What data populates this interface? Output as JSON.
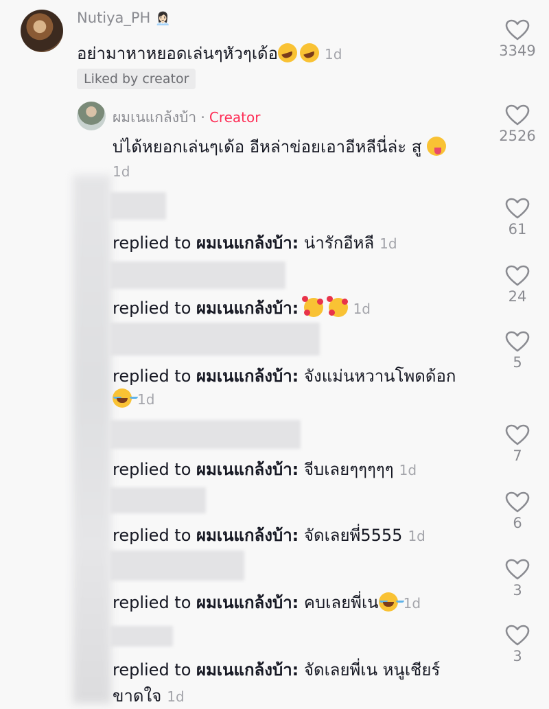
{
  "main_comment": {
    "username": "Nutiya_PH",
    "username_emoji": "👩🏻‍💼",
    "text": "อย่ามาหาหยอดเล่นๆหัวๆเด้อ",
    "time": "1d",
    "liked_badge": "Liked by creator",
    "likes": "3349"
  },
  "creator_reply": {
    "username": "ผมเนแกล้งบ้า",
    "separator": "·",
    "tag": "Creator",
    "text": "บ่ได้หยอกเล่นๆเด้อ อีหล่าข่อยเอาอีหลีนี่ล่ะ สู",
    "time": "1d",
    "likes": "2526"
  },
  "replies": [
    {
      "prefix": "replied to",
      "target": "ผมเนแกล้งบ้า:",
      "text": "น่ารักอีหลี",
      "time": "1d",
      "likes": "61"
    },
    {
      "prefix": "replied to",
      "target": "ผมเนแกล้งบ้า:",
      "text": "",
      "time": "1d",
      "likes": "24"
    },
    {
      "prefix": "replied to",
      "target": "ผมเนแกล้งบ้า:",
      "text": "จังแม่นหวานโพดด้อก",
      "time": "1d",
      "likes": "5"
    },
    {
      "prefix": "replied to",
      "target": "ผมเนแกล้งบ้า:",
      "text": "จีบเลยๆๆๆๆๆ",
      "time": "1d",
      "likes": "7"
    },
    {
      "prefix": "replied to",
      "target": "ผมเนแกล้งบ้า:",
      "text": "จัดเลยพี่5555",
      "time": "1d",
      "likes": "6"
    },
    {
      "prefix": "replied to",
      "target": "ผมเนแกล้งบ้า:",
      "text": "คบเลยพี่เน",
      "time": "1d",
      "likes": "3"
    },
    {
      "prefix": "replied to",
      "target": "ผมเนแกล้งบ้า:",
      "text": "จัดเลยพี่เน หนูเชียร์",
      "text_line2": "ขาดใจ",
      "time": "1d",
      "likes": "3"
    }
  ],
  "icons": {
    "like": "heart-outline-icon"
  },
  "colors": {
    "background": "#f8f8f8",
    "creator_tag": "#fe2c55",
    "muted_text": "#8a8b91",
    "badge_bg": "#ebebec"
  }
}
